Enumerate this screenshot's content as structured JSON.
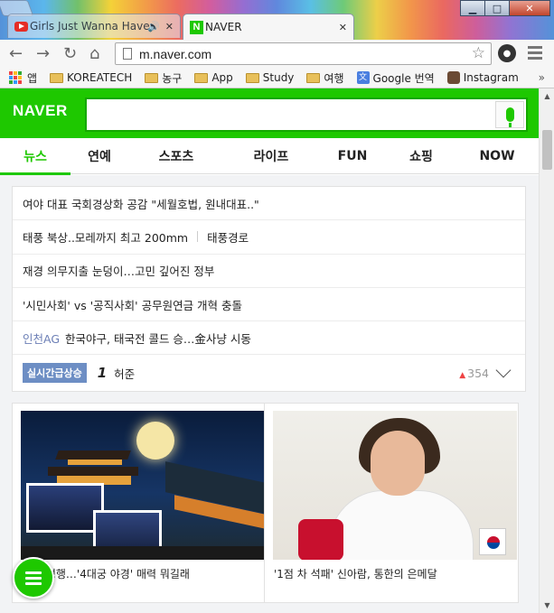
{
  "browser": {
    "tabs": [
      {
        "title": "Girls Just Wanna Have",
        "icon": "youtube-icon",
        "active": false
      },
      {
        "title": "NAVER",
        "icon": "naver-icon",
        "active": true
      }
    ],
    "url": "m.naver.com",
    "bookmarks": [
      {
        "label": "앱",
        "icon": "apps-icon"
      },
      {
        "label": "KOREATECH",
        "icon": "folder-icon"
      },
      {
        "label": "농구",
        "icon": "folder-icon"
      },
      {
        "label": "App",
        "icon": "folder-icon"
      },
      {
        "label": "Study",
        "icon": "folder-icon"
      },
      {
        "label": "여행",
        "icon": "folder-icon"
      },
      {
        "label": "Google 번역",
        "icon": "google-translate-icon"
      },
      {
        "label": "Instagram",
        "icon": "instagram-icon"
      }
    ],
    "bookmarks_more": "»"
  },
  "naver": {
    "logo": "NAVER",
    "search": {
      "value": ""
    },
    "menu": [
      {
        "label": "뉴스",
        "active": true
      },
      {
        "label": "연예",
        "active": false
      },
      {
        "label": "스포츠",
        "active": false
      },
      {
        "label": "라이프",
        "active": false
      },
      {
        "label": "FUN",
        "active": false
      },
      {
        "label": "쇼핑",
        "active": false
      },
      {
        "label": "NOW",
        "active": false
      }
    ],
    "headlines": [
      {
        "text": "여야 대표 국회경상화 공감 \"세월호법, 원내대표..\""
      },
      {
        "text": "태풍 북상..모레까지 최고 200mm",
        "extra": "태풍경로"
      },
      {
        "text": "재경 의무지출 눈덩이…고민 깊어진 정부"
      },
      {
        "text": "'시민사회' vs '공직사회' 공무원연금 개혁 충돌"
      },
      {
        "tag": "인천AG",
        "text": "한국야구, 태국전 콜드 승…金사냥 시동"
      }
    ],
    "trending": {
      "badge": "실시간급상승",
      "rank": "1",
      "keyword": "허준",
      "count": "354"
    },
    "photo_news": [
      {
        "caption": "…지 성행…'4대궁 야경' 매력 뭐길래"
      },
      {
        "caption": "'1점 차 석패' 신아람, 통한의 은메달"
      }
    ]
  },
  "colors": {
    "naver_green": "#1ec800",
    "trend_badge": "#6d8ec4",
    "tag_blue": "#6c7fb6"
  }
}
